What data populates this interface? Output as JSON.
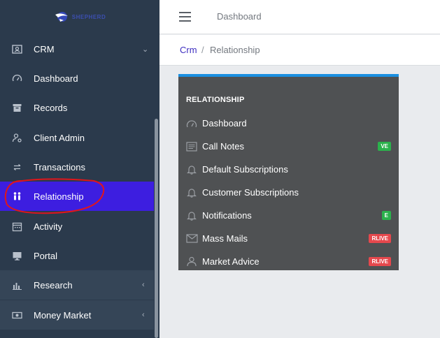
{
  "sidebar": {
    "logo_text": "SHEPHERD",
    "items": [
      {
        "label": "CRM",
        "icon": "id-card-icon",
        "chevron": "⌄"
      },
      {
        "label": "Dashboard",
        "icon": "gauge-icon"
      },
      {
        "label": "Records",
        "icon": "archive-icon"
      },
      {
        "label": "Client Admin",
        "icon": "user-gear-icon"
      },
      {
        "label": "Transactions",
        "icon": "exchange-icon"
      },
      {
        "label": "Relationship",
        "icon": "people-icon"
      },
      {
        "label": "Activity",
        "icon": "calendar-icon"
      },
      {
        "label": "Portal",
        "icon": "monitor-icon"
      },
      {
        "label": "Research",
        "icon": "bar-chart-icon",
        "chevron": "‹"
      },
      {
        "label": "Money Market",
        "icon": "money-icon",
        "chevron": "‹"
      }
    ]
  },
  "header": {
    "title": "Dashboard"
  },
  "breadcrumb": {
    "root": "Crm",
    "separator": "/",
    "current": "Relationship"
  },
  "panel": {
    "title": "RELATIONSHIP",
    "items": [
      {
        "label": "Dashboard",
        "icon": "gauge-icon"
      },
      {
        "label": "Call Notes",
        "icon": "notes-icon",
        "badge": "VE",
        "badge_color": "#2bb24c"
      },
      {
        "label": "Default Subscriptions",
        "icon": "bell-icon"
      },
      {
        "label": "Customer Subscriptions",
        "icon": "bell-icon"
      },
      {
        "label": "Notifications",
        "icon": "bell-icon",
        "badge": "E",
        "badge_color": "#2bb24c"
      },
      {
        "label": "Mass Mails",
        "icon": "envelope-icon",
        "badge": "RLIVE",
        "badge_color": "#e5484d"
      },
      {
        "label": "Market Advice",
        "icon": "advisor-icon",
        "badge": "RLIVE",
        "badge_color": "#e5484d"
      }
    ]
  },
  "colors": {
    "sidebar": "#2b3a4c",
    "active": "#3d1ee0",
    "panel": "#4f5153",
    "accent": "#1a8fe0"
  }
}
